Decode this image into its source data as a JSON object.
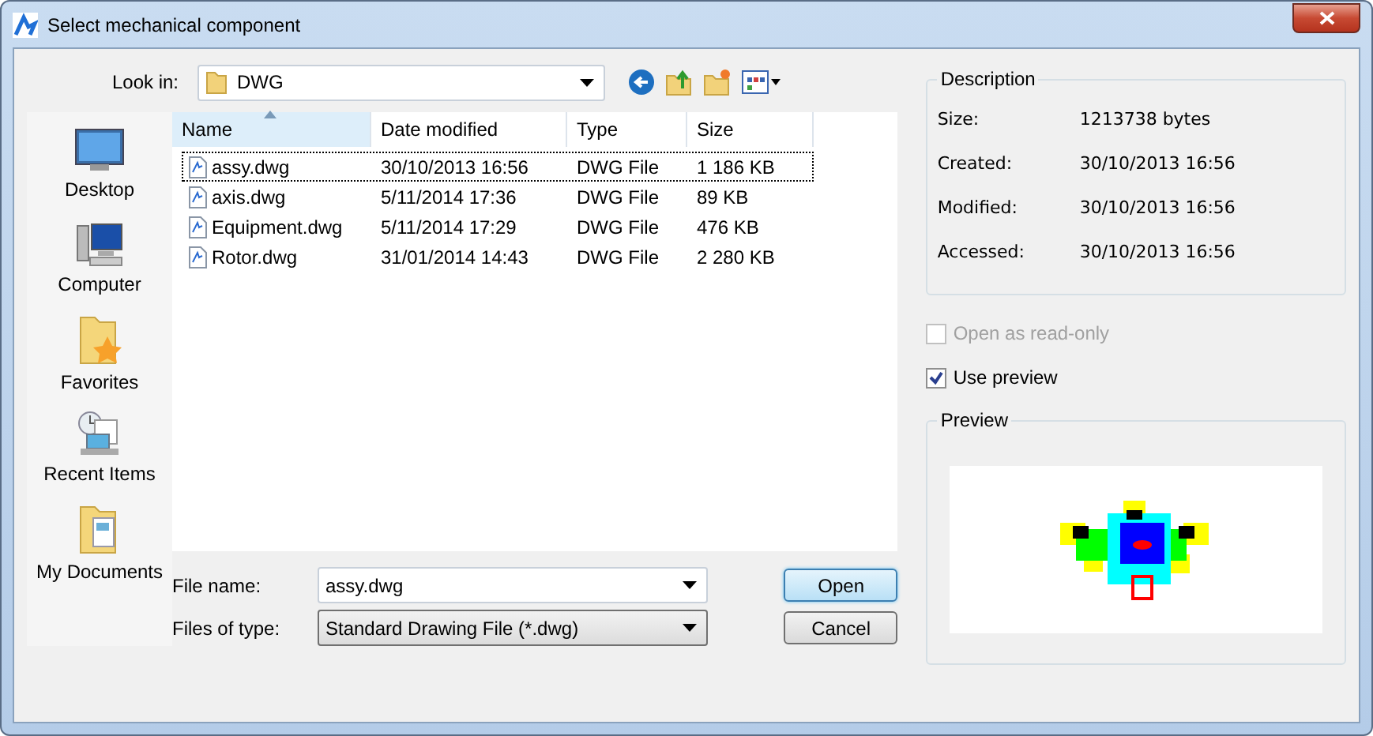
{
  "window": {
    "title": "Select mechanical component"
  },
  "look_in": {
    "label": "Look in:",
    "value": "DWG"
  },
  "places": [
    {
      "label": "Desktop",
      "kind": "desktop"
    },
    {
      "label": "Computer",
      "kind": "computer"
    },
    {
      "label": "Favorites",
      "kind": "favorites"
    },
    {
      "label": "Recent Items",
      "kind": "recent"
    },
    {
      "label": "My Documents",
      "kind": "documents"
    }
  ],
  "columns": [
    {
      "label": "Name",
      "sorted": true
    },
    {
      "label": "Date modified",
      "sorted": false
    },
    {
      "label": "Type",
      "sorted": false
    },
    {
      "label": "Size",
      "sorted": false
    }
  ],
  "rows": [
    {
      "name": "assy.dwg",
      "date": "30/10/2013 16:56",
      "type": "DWG File",
      "size": "1 186 KB",
      "focused": true
    },
    {
      "name": "axis.dwg",
      "date": "5/11/2014 17:36",
      "type": "DWG File",
      "size": "89 KB",
      "focused": false
    },
    {
      "name": "Equipment.dwg",
      "date": "5/11/2014 17:29",
      "type": "DWG File",
      "size": "476 KB",
      "focused": false
    },
    {
      "name": "Rotor.dwg",
      "date": "31/01/2014 14:43",
      "type": "DWG File",
      "size": "2 280 KB",
      "focused": false
    }
  ],
  "file_name": {
    "label": "File name:",
    "value": "assy.dwg"
  },
  "file_type": {
    "label": "Files of type:",
    "value": "Standard Drawing File (*.dwg)"
  },
  "buttons": [
    {
      "label": "Open",
      "default": true
    },
    {
      "label": "Cancel",
      "default": false
    }
  ],
  "description": {
    "title": "Description",
    "rows": [
      {
        "label": "Size:",
        "value": "1213738 bytes"
      },
      {
        "label": "Created:",
        "value": "30/10/2013 16:56"
      },
      {
        "label": "Modified:",
        "value": "30/10/2013 16:56"
      },
      {
        "label": "Accessed:",
        "value": "30/10/2013 16:56"
      }
    ]
  },
  "options": [
    {
      "label": "Open as read-only",
      "checked": false,
      "disabled": true
    },
    {
      "label": "Use preview",
      "checked": true,
      "disabled": false
    }
  ],
  "preview": {
    "title": "Preview"
  }
}
